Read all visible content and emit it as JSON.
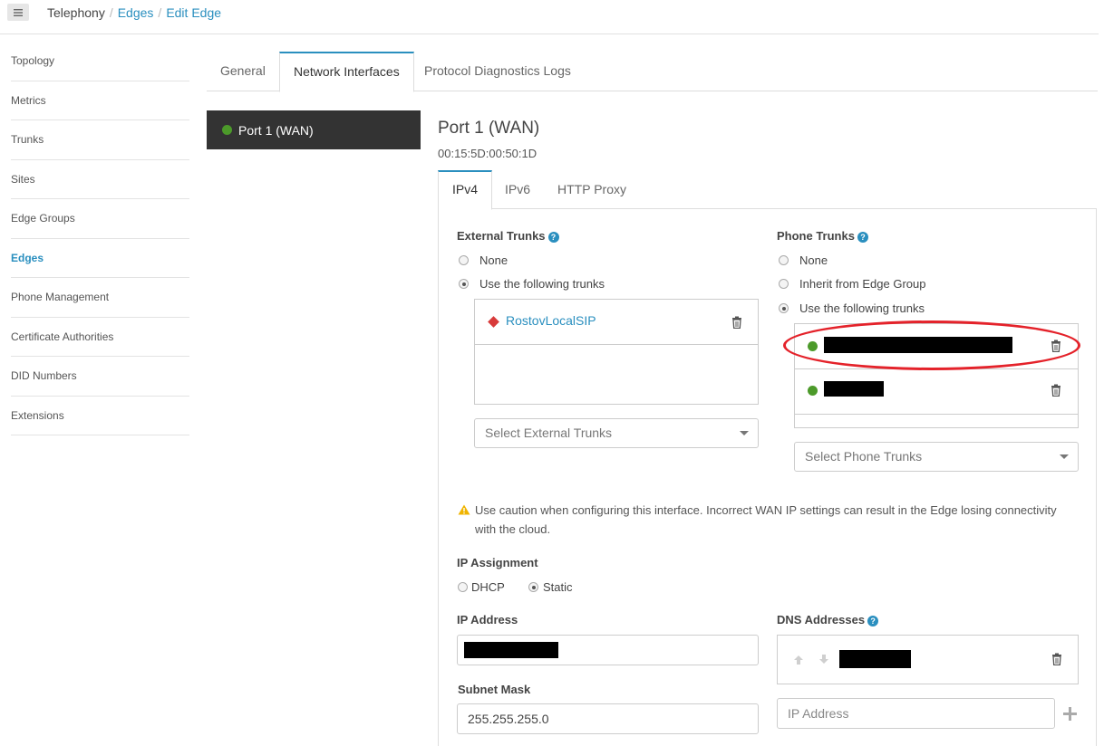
{
  "breadcrumb": {
    "root": "Telephony",
    "sep1": "/",
    "edges": "Edges",
    "sep2": "/",
    "current": "Edit Edge"
  },
  "sidebar": {
    "items": [
      {
        "label": "Topology"
      },
      {
        "label": "Metrics"
      },
      {
        "label": "Trunks"
      },
      {
        "label": "Sites"
      },
      {
        "label": "Edge Groups"
      },
      {
        "label": "Edges",
        "active": true
      },
      {
        "label": "Phone Management"
      },
      {
        "label": "Certificate Authorities"
      },
      {
        "label": "DID Numbers"
      },
      {
        "label": "Extensions"
      }
    ]
  },
  "tabs": {
    "general": "General",
    "network_interfaces": "Network Interfaces",
    "protocol_logs": "Protocol Diagnostics Logs",
    "active": "Network Interfaces"
  },
  "port": {
    "list_item": "Port 1 (WAN)",
    "status_color": "#4c9a2a",
    "title": "Port 1 (WAN)",
    "mac": "00:15:5D:00:50:1D"
  },
  "sub_tabs": {
    "ipv4": "IPv4",
    "ipv6": "IPv6",
    "http_proxy": "HTTP Proxy",
    "active": "IPv4"
  },
  "external_trunks": {
    "label": "External Trunks",
    "help": "?",
    "options": {
      "none": "None",
      "use": "Use the following trunks"
    },
    "selected": "Use the following trunks",
    "trunks": [
      "RostovLocalSIP"
    ],
    "select_placeholder": "Select External Trunks"
  },
  "phone_trunks": {
    "label": "Phone Trunks",
    "help": "?",
    "options": {
      "none": "None",
      "inherit": "Inherit from Edge Group",
      "use": "Use the following trunks"
    },
    "selected": "Use the following trunks",
    "select_placeholder": "Select Phone Trunks"
  },
  "warning": {
    "text": "Use caution when configuring this interface. Incorrect WAN IP settings can result in the Edge losing connectivity with the cloud."
  },
  "ip_assignment": {
    "label": "IP Assignment",
    "dhcp": "DHCP",
    "static": "Static",
    "selected": "Static"
  },
  "ip_address": {
    "label": "IP Address"
  },
  "subnet_mask": {
    "label": "Subnet Mask",
    "value": "255.255.255.0"
  },
  "dns": {
    "label": "DNS Addresses",
    "help": "?",
    "input_placeholder": "IP Address"
  },
  "colors": {
    "accent": "#2a8fbf",
    "dark": "#333333",
    "status_green": "#4c9a2a",
    "trunk_red": "#d83a3a",
    "annotation_red": "#e4222a",
    "warning_yellow": "#f0b400"
  }
}
